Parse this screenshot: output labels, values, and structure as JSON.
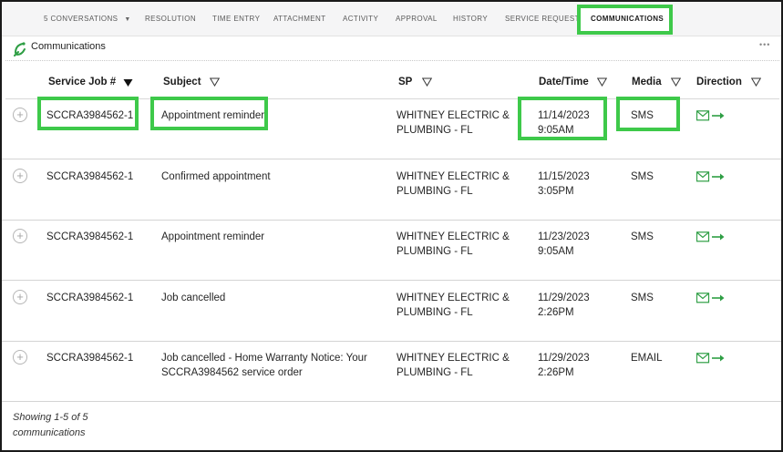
{
  "tabs": [
    {
      "label": "5 CONVERSATIONS",
      "has_dropdown": true
    },
    {
      "label": "RESOLUTION"
    },
    {
      "label": "TIME ENTRY"
    },
    {
      "label": "ATTACHMENT"
    },
    {
      "label": "ACTIVITY"
    },
    {
      "label": "APPROVAL"
    },
    {
      "label": "HISTORY"
    },
    {
      "label": "SERVICE REQUEST"
    },
    {
      "label": "COMMUNICATIONS",
      "active": true
    }
  ],
  "section": {
    "title": "Communications",
    "icon": "communications-icon",
    "more_icon": "more-options-icon"
  },
  "table": {
    "columns": [
      {
        "label": "Service Job #",
        "filter_icon": "sort-desc-filled-icon"
      },
      {
        "label": "Subject",
        "filter_icon": "filter-icon"
      },
      {
        "label": "SP",
        "filter_icon": "filter-icon"
      },
      {
        "label": "Date/Time",
        "filter_icon": "filter-icon"
      },
      {
        "label": "Media",
        "filter_icon": "filter-icon"
      },
      {
        "label": "Direction",
        "filter_icon": "filter-icon"
      }
    ],
    "rows": [
      {
        "job": "SCCRA3984562-1",
        "subject": "Appointment reminder",
        "sp": "WHITNEY ELECTRIC & PLUMBING - FL",
        "date": "11/14/2023",
        "time": "9:05AM",
        "media": "SMS",
        "direction_icon": "outbound-email-icon"
      },
      {
        "job": "SCCRA3984562-1",
        "subject": "Confirmed appointment",
        "sp": "WHITNEY ELECTRIC & PLUMBING - FL",
        "date": "11/15/2023",
        "time": "3:05PM",
        "media": "SMS",
        "direction_icon": "outbound-email-icon"
      },
      {
        "job": "SCCRA3984562-1",
        "subject": "Appointment reminder",
        "sp": "WHITNEY ELECTRIC & PLUMBING - FL",
        "date": "11/23/2023",
        "time": "9:05AM",
        "media": "SMS",
        "direction_icon": "outbound-email-icon"
      },
      {
        "job": "SCCRA3984562-1",
        "subject": "Job cancelled",
        "sp": "WHITNEY ELECTRIC & PLUMBING - FL",
        "date": "11/29/2023",
        "time": "2:26PM",
        "media": "SMS",
        "direction_icon": "outbound-email-icon"
      },
      {
        "job": "SCCRA3984562-1",
        "subject": "Job cancelled - Home Warranty Notice: Your SCCRA3984562 service order",
        "sp": "WHITNEY ELECTRIC & PLUMBING - FL",
        "date": "11/29/2023",
        "time": "2:26PM",
        "media": "EMAIL",
        "direction_icon": "outbound-email-icon"
      }
    ]
  },
  "footer": {
    "text": "Showing 1-5 of 5 communications"
  },
  "colors": {
    "accent_green": "#2e9e44",
    "highlight_green": "#3ec94a"
  }
}
